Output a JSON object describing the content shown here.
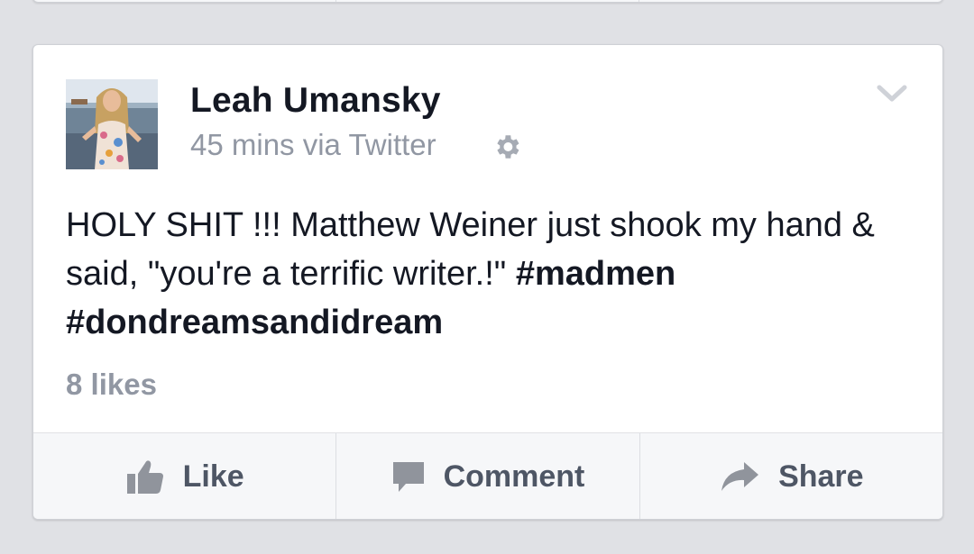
{
  "post": {
    "author": "Leah Umansky",
    "meta": "45 mins via Twitter",
    "text_plain": "HOLY  SHIT !!! Matthew Weiner just shook my hand & said, \"you're a terrific writer.!\" ",
    "hashtag_1": "#madmen",
    "hashtag_2": "#dondreamsandidream",
    "likes": "8 likes"
  },
  "actions": {
    "like_label": "Like",
    "comment_label": "Comment",
    "share_label": "Share"
  },
  "icons": {
    "privacy": "gear-icon",
    "menu": "chevron-down-icon",
    "like": "thumbs-up-icon",
    "comment": "speech-bubble-icon",
    "share": "share-arrow-icon"
  },
  "colors": {
    "background": "#e0e1e5",
    "card": "#ffffff",
    "text": "#141823",
    "muted": "#9197a3",
    "action_text": "#4e5665"
  }
}
